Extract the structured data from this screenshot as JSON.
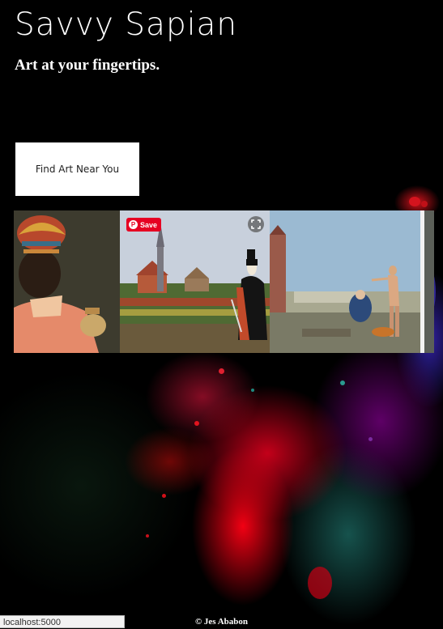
{
  "header": {
    "title": "Savvy Sapian",
    "tagline": "Art at your fingertips."
  },
  "actions": {
    "find_art_label": "Find Art Near You"
  },
  "gallery": {
    "save_label": "Save",
    "pin_glyph": "P",
    "icons": [
      "pinterest-icon",
      "expand-icon"
    ]
  },
  "status_bar": {
    "url": "localhost:5000"
  },
  "footer": {
    "credit": "© Jes Ababon"
  },
  "colors": {
    "background": "#000000",
    "save_button": "#e60023",
    "button_bg": "#ffffff"
  }
}
